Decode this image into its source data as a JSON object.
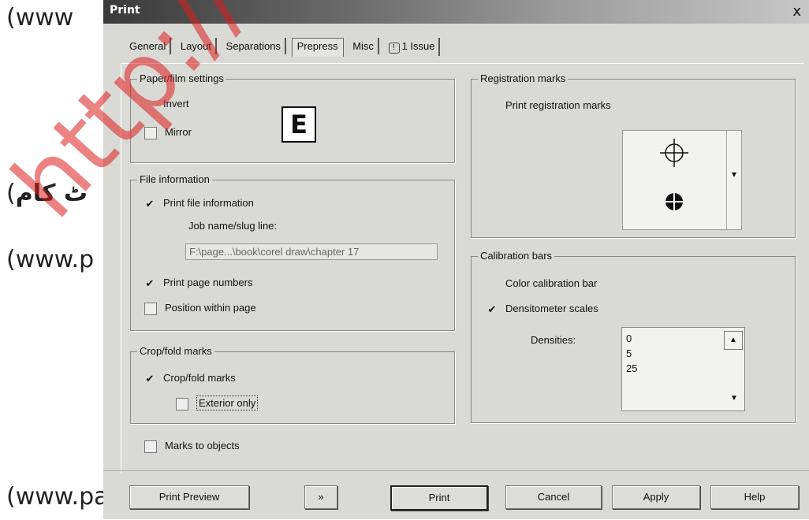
{
  "background": {
    "left_lines": [
      "(www",
      "(",
      "(www.p",
      "(www.pa"
    ],
    "urdu_text": "ٹ کام",
    "watermark": "http://comp"
  },
  "dialog": {
    "title": "Print",
    "close_label": "x"
  },
  "tabs": [
    {
      "label": "General"
    },
    {
      "label": "Layout"
    },
    {
      "label": "Separations"
    },
    {
      "label": "Prepress",
      "active": true
    },
    {
      "label": "Misc"
    },
    {
      "label": "1 Issue"
    }
  ],
  "paper_film": {
    "title": "Paper/film settings",
    "invert": {
      "label": "Invert",
      "checked": false
    },
    "mirror": {
      "label": "Mirror",
      "checked": false
    },
    "preview_letter": "E"
  },
  "file_info": {
    "title": "File information",
    "print_file_info": {
      "label": "Print file information",
      "checked": true
    },
    "job_name_label": "Job name/slug line:",
    "job_name_value": "F:\\page...\\book\\corel draw\\chapter 17",
    "print_page_numbers": {
      "label": "Print page numbers",
      "checked": true
    },
    "position_within_page": {
      "label": "Position within page",
      "checked": false
    }
  },
  "crop_fold": {
    "title": "Crop/fold marks",
    "crop_fold_marks": {
      "label": "Crop/fold marks",
      "checked": true
    },
    "exterior_only": {
      "label": "Exterior only",
      "checked": false
    }
  },
  "marks_to_objects": {
    "label": "Marks to objects",
    "checked": false
  },
  "registration": {
    "title": "Registration marks",
    "print_registration_marks": {
      "label": "Print registration marks",
      "checked": false
    },
    "style_icons": [
      "registration-crosshair-icon",
      "registration-bullseye-icon"
    ]
  },
  "calibration": {
    "title": "Calibration bars",
    "color_bar": {
      "label": "Color calibration bar",
      "checked": false
    },
    "densitometer": {
      "label": "Densitometer scales",
      "checked": true
    },
    "densities_label": "Densities:",
    "densities": [
      "0",
      "5",
      "25"
    ]
  },
  "buttons": {
    "print_preview": "Print Preview",
    "expand": "»",
    "print": "Print",
    "cancel": "Cancel",
    "apply": "Apply",
    "help": "Help"
  },
  "colors": {
    "dialog_bg": "#d9d9d6",
    "watermark": "#dc1e1e"
  }
}
